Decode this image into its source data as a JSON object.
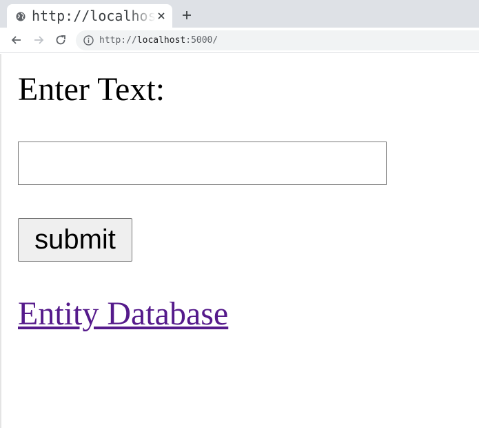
{
  "browser": {
    "tab": {
      "title": "http://localhost:5000/",
      "favicon": "globe-icon",
      "close_icon": "close-icon"
    },
    "new_tab_icon": "plus-icon",
    "nav": {
      "back_icon": "back-arrow-icon",
      "forward_icon": "forward-arrow-icon",
      "reload_icon": "reload-icon"
    },
    "address_bar": {
      "site_info_icon": "info-icon",
      "scheme": "http://",
      "host": "localhost",
      "port": ":5000/"
    }
  },
  "page": {
    "heading": "Enter Text:",
    "text_input": {
      "value": "",
      "placeholder": ""
    },
    "submit_label": "submit",
    "link_label": "Entity Database"
  },
  "colors": {
    "tabstrip": "#dee1e6",
    "omnibox": "#f1f3f4",
    "visited_link": "#551a8b",
    "button_face": "#efefef",
    "border": "#767676"
  }
}
